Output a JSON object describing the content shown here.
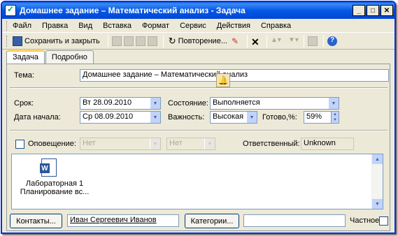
{
  "window": {
    "title": "Домашнее задание – Математический анализ - Задача"
  },
  "menu": [
    "Файл",
    "Правка",
    "Вид",
    "Вставка",
    "Формат",
    "Сервис",
    "Действия",
    "Справка"
  ],
  "toolbar": {
    "save_close": "Сохранить и закрыть",
    "recurrence": "Повторение..."
  },
  "tabs": [
    "Задача",
    "Подробно"
  ],
  "form": {
    "subject_label": "Тема:",
    "subject_value": "Домашнее задание – Математический  анализ",
    "due_label": "Срок:",
    "due_value": "Вт 28.09.2010",
    "start_label": "Дата начала:",
    "start_value": "Ср 08.09.2010",
    "status_label": "Состояние:",
    "status_value": "Выполняется",
    "priority_label": "Важность:",
    "priority_value": "Высокая",
    "complete_label": "Готово,%:",
    "complete_value": "59%",
    "reminder_label": "Оповещение:",
    "reminder_date": "Нет",
    "reminder_time": "Нет",
    "owner_label": "Ответственный:",
    "owner_value": "Unknown"
  },
  "attachment": {
    "name_line1": "Лабораторная 1",
    "name_line2": "Планирование вс..."
  },
  "footer": {
    "contacts_button": "Контакты...",
    "contact_value": "Иван Сергеевич Иванов",
    "categories_button": "Категории...",
    "categories_value": "",
    "private_label": "Частное"
  }
}
